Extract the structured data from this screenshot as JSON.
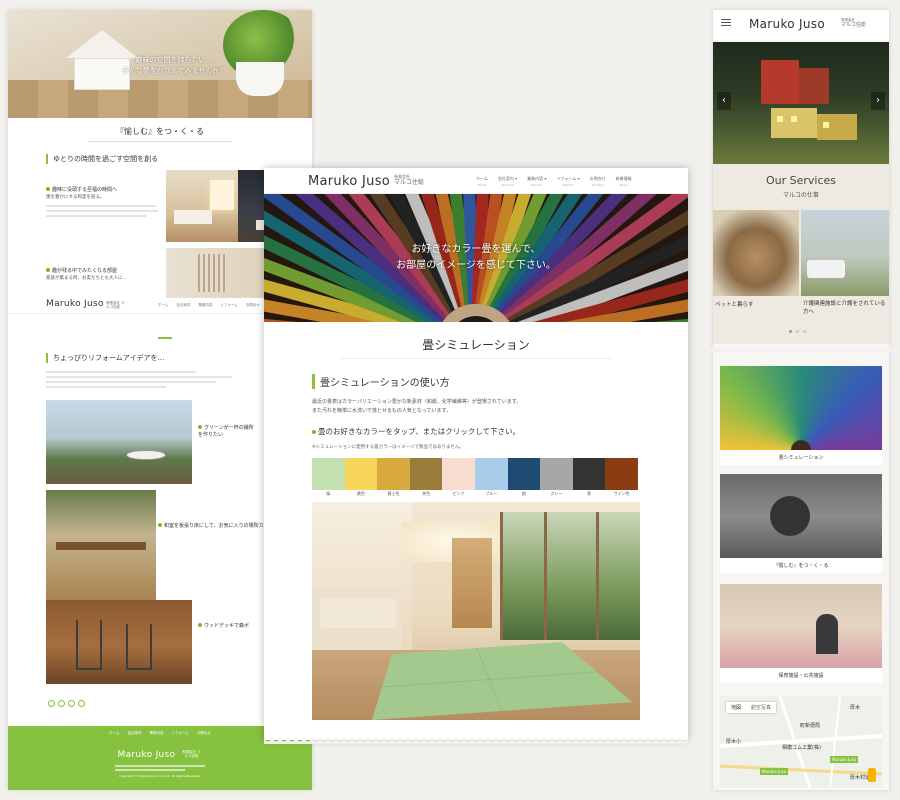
{
  "left": {
    "hero_text": [
      "趣味の空間を持ちたい…",
      "そんな夢をかなえてみませんか？"
    ],
    "section_title": "『愉しむ』をつ・く・る",
    "sub_heading": "ゆとりの時間を過ごす空間を創る",
    "item1_title": "趣味に没頭する至福の時間へ",
    "item1_sub": "僕を豊かにする和室を創る。",
    "item2_title": "趣が残る中でみたくなる部屋",
    "item2_sub": "家族が集まる時、お友だちとも大人に..",
    "header_logo": "Maruko Juso",
    "header_logo_sub": "有限会社 マルコ住総",
    "nav": [
      "ホーム",
      "会社案内",
      "業務内容",
      "リフォーム",
      "お問合せ"
    ],
    "sub_heading2": "ちょっぴりリフォームアイデアを…",
    "photo1_caption": "グリーンが一杯の撮所を作りたい",
    "photo2_caption": "和室を板張り床にして、お気に入りの場所カフェ",
    "photo3_caption": "ウッドデッキで森ボ",
    "footer_logo": "Maruko Juso",
    "footer_logo_sub": "有限会社 マルコ住総",
    "footer_nav": [
      "ホーム",
      "会社案内",
      "業務内容",
      "リフォーム",
      "お問合せ"
    ],
    "copyright": "Copyright © Maruko Juso Co., Ltd. All Rights Reserved."
  },
  "center": {
    "logo": "Maruko Juso",
    "logo_sub_small": "有限会社",
    "logo_sub": "マルコ住総",
    "nav": [
      {
        "label": "ホーム",
        "sub": "Home"
      },
      {
        "label": "会社案内",
        "sub": "About us"
      },
      {
        "label": "業務内容",
        "sub": "Service"
      },
      {
        "label": "リフォーム",
        "sub": "Reform"
      },
      {
        "label": "お問合せ",
        "sub": "Contact"
      },
      {
        "label": "新着情報",
        "sub": "News"
      }
    ],
    "hero_text": [
      "お好きなカラー畳を選んで、",
      "お部屋のイメージを感じて下さい。"
    ],
    "page_title": "畳シミュレーション",
    "section_heading": "畳シミュレーションの使い方",
    "desc_line1": "最近の畳表はカラーバリエーション豊かな新素材（和紙、化学繊維等）が登場されています。",
    "desc_line2": "また汚れを簡単に水洗いで落とせるもの人気となっています。",
    "instruction": "畳のお好きなカラーをタップ、またはクリックして下さい。",
    "note": "※シミュレーションに使用する畳カラーはイメージで製品ではありません。",
    "swatches": [
      {
        "label": "緑",
        "color": "#c4e0b0"
      },
      {
        "label": "黄色",
        "color": "#f6d55a"
      },
      {
        "label": "黄土色",
        "color": "#d8a93c"
      },
      {
        "label": "茶色",
        "color": "#9b7c3a"
      },
      {
        "label": "ピンク",
        "color": "#f6ddd0"
      },
      {
        "label": "ブルー",
        "color": "#a9cde8"
      },
      {
        "label": "紺",
        "color": "#1f4a73"
      },
      {
        "label": "グレー",
        "color": "#a7a7a7"
      },
      {
        "label": "黒",
        "color": "#333333"
      },
      {
        "label": "ワイン色",
        "color": "#8a3c12"
      }
    ],
    "tatami_color": "#a4c98e"
  },
  "right": {
    "logo": "Maruko Juso",
    "logo_sub_small": "有限会社",
    "logo_sub": "マルコ住総",
    "services_title": "Our Services",
    "services_sub": "マルコの仕事",
    "service_caption1": "ペットと暮らす",
    "service_caption2": "介護関連施設と介護をされている方へ",
    "card1_caption": "畳シミュレーション",
    "card2_caption": "『愉しむ』をつ・く・る",
    "card3_caption": "保育施設・公共施設",
    "map_tabs": [
      "地図",
      "航空写真"
    ],
    "map_labels": [
      "厚木",
      "厚木小",
      "相模ゴム工業(株)",
      "厚木村道",
      "町新便局"
    ],
    "map_marker": "Maruko Juso"
  }
}
